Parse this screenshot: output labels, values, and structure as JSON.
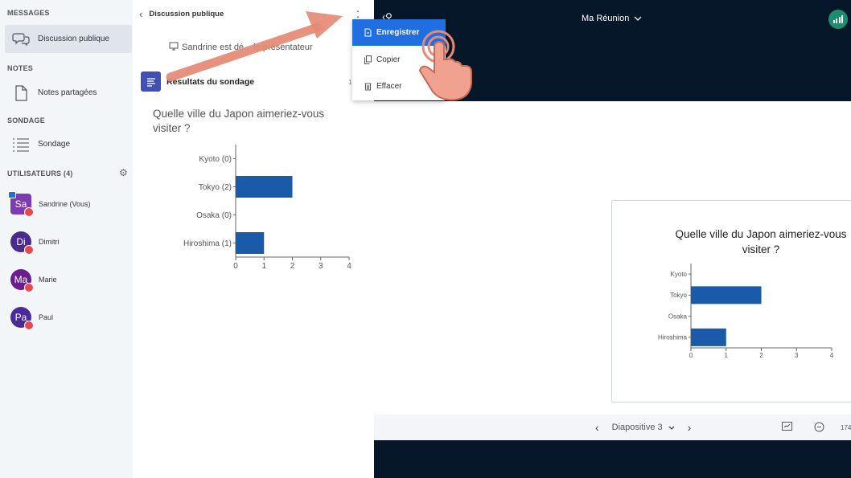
{
  "sidebar": {
    "messages_title": "MESSAGES",
    "public_chat": "Discussion publique",
    "notes_title": "NOTES",
    "shared_notes": "Notes partagées",
    "poll_title": "SONDAGE",
    "poll_item": "Sondage",
    "users_title": "UTILISATEURS (4)",
    "users": [
      {
        "initials": "Sa",
        "name": "Sandrine (Vous)",
        "color": "#7e3bb0"
      },
      {
        "initials": "Di",
        "name": "Dimitri",
        "color": "#4a2a8f"
      },
      {
        "initials": "Ma",
        "name": "Marie",
        "color": "#6b1d8f"
      },
      {
        "initials": "Pa",
        "name": "Paul",
        "color": "#4b2a9a"
      }
    ]
  },
  "chat": {
    "header": "Discussion publique",
    "system_message": "Sandrine est dé... le présentateur",
    "poll_heading": "Résultats du sondage",
    "poll_time": "1",
    "poll_question": "Quelle ville du Japon aimeriez-vous visiter ?"
  },
  "menu": {
    "save": "Enregistrer",
    "copy": "Copier",
    "clear": "Effacer"
  },
  "presentation": {
    "meeting_title": "Ma Réunion",
    "slide_label": "Diapositive 3",
    "zoom": "174",
    "slide_title": "Quelle ville du Japon aimeriez-vous visiter ?"
  },
  "colors": {
    "bar": "#1a5aa8",
    "accent": "#1f6fe0",
    "dark": "#06172a"
  },
  "chart_data": [
    {
      "type": "bar",
      "orientation": "horizontal",
      "categories": [
        "Kyoto (0)",
        "Tokyo (2)",
        "Osaka (0)",
        "Hiroshima (1)"
      ],
      "values": [
        0,
        2,
        0,
        1
      ],
      "xlim": [
        0,
        4
      ],
      "xticks": [
        "0",
        "1",
        "2",
        "3",
        "4"
      ]
    },
    {
      "type": "bar",
      "orientation": "horizontal",
      "categories": [
        "Kyoto",
        "Tokyo",
        "Osaka",
        "Hiroshima"
      ],
      "values": [
        0,
        2,
        0,
        1
      ],
      "xlim": [
        0,
        4
      ],
      "xticks": [
        "0",
        "1",
        "2",
        "3",
        "4"
      ]
    }
  ]
}
